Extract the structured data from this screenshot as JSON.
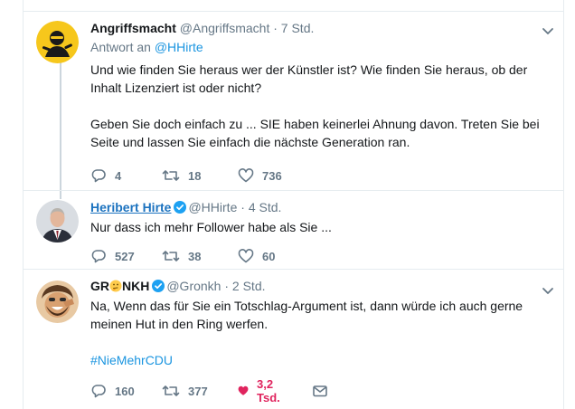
{
  "tweets": [
    {
      "name": "Angriffsmacht",
      "handle": "@Angriffsmacht",
      "separator": "·",
      "time": "7 Std.",
      "reply_prefix": "Antwort an",
      "reply_mention": "@HHirte",
      "paragraphs": [
        "Und wie finden Sie heraus wer der Künstler ist? Wie finden Sie heraus, ob der Inhalt Lizenziert ist oder nicht?",
        "Geben Sie doch einfach zu ... SIE haben keinerlei Ahnung davon. Treten Sie bei Seite und lassen Sie einfach die nächste Generation ran."
      ],
      "replies": "4",
      "retweets": "18",
      "likes": "736",
      "liked": false,
      "avatar_icon": "ninja-avatar-icon"
    },
    {
      "name": "Heribert Hirte",
      "verified": true,
      "handle": "@HHirte",
      "separator": "·",
      "time": "4 Std.",
      "paragraphs": [
        "Nur dass ich mehr Follower habe als Sie ..."
      ],
      "replies": "527",
      "retweets": "38",
      "likes": "60",
      "liked": false,
      "avatar_icon": "person-photo-avatar"
    },
    {
      "name_prefix": "GR",
      "name_emoji": "thinking-face-emoji",
      "name_suffix": "NKH",
      "verified": true,
      "handle": "@Gronkh",
      "separator": "·",
      "time": "2 Std.",
      "paragraphs": [
        "Na, Wenn das für Sie ein Totschlag-Argument ist, dann würde ich auch gerne meinen Hut in den Ring werfen."
      ],
      "hashtag": "#NieMehrCDU",
      "replies": "160",
      "retweets": "377",
      "likes": "3,2 Tsd.",
      "liked": true,
      "avatar_icon": "cartoon-face-avatar"
    }
  ],
  "colors": {
    "link": "#1b95e0",
    "secondary_text": "#657786",
    "like_active": "#e0245e",
    "verified": "#1da1f2",
    "divider": "#e6ecf0"
  }
}
